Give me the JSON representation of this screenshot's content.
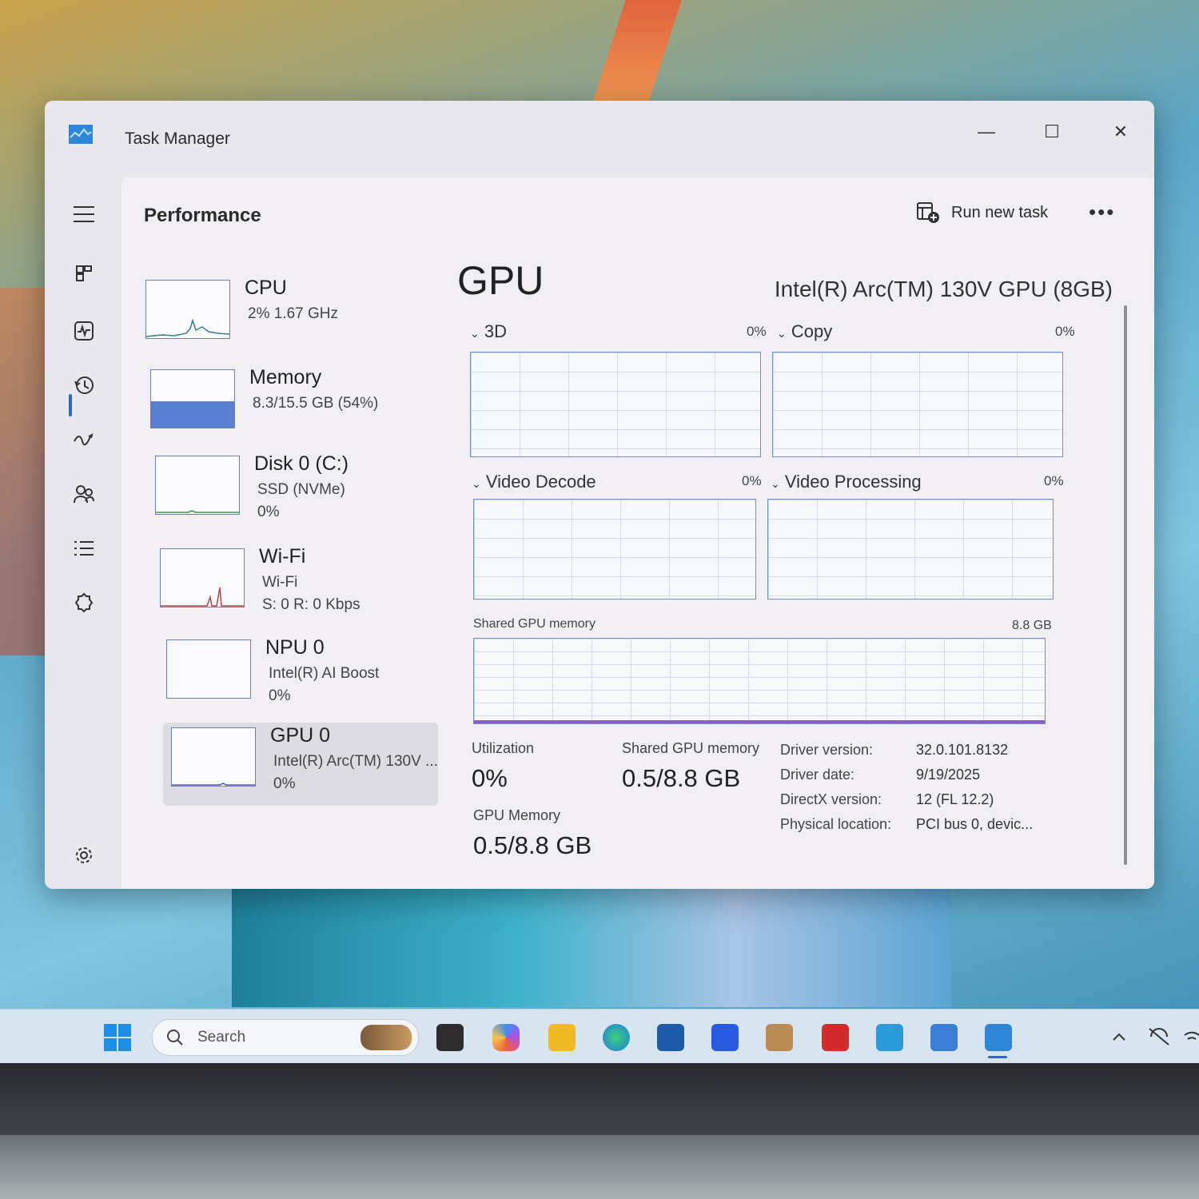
{
  "window": {
    "title": "Task Manager",
    "controls": {
      "minimize": "—",
      "maximize": "☐",
      "close": "✕"
    }
  },
  "header": {
    "title": "Performance",
    "run_task_label": "Run new task",
    "more_label": "•••"
  },
  "devices": [
    {
      "name": "CPU",
      "line1": "2%  1.67 GHz",
      "line2": ""
    },
    {
      "name": "Memory",
      "line1": "8.3/15.5 GB (54%)",
      "line2": ""
    },
    {
      "name": "Disk 0 (C:)",
      "line1": "SSD (NVMe)",
      "line2": "0%"
    },
    {
      "name": "Wi-Fi",
      "line1": "Wi-Fi",
      "line2": "S: 0  R: 0 Kbps"
    },
    {
      "name": "NPU 0",
      "line1": "Intel(R) AI Boost",
      "line2": "0%"
    },
    {
      "name": "GPU 0",
      "line1": "Intel(R) Arc(TM) 130V ...",
      "line2": "0%"
    }
  ],
  "gpu": {
    "title": "GPU",
    "model": "Intel(R) Arc(TM) 130V GPU (8GB)",
    "engines": [
      {
        "label": "3D",
        "pct": "0%"
      },
      {
        "label": "Copy",
        "pct": "0%"
      },
      {
        "label": "Video Decode",
        "pct": "0%"
      },
      {
        "label": "Video Processing",
        "pct": "0%"
      }
    ],
    "shared_memory": {
      "label": "Shared GPU memory",
      "max": "8.8 GB"
    },
    "stats": {
      "utilization_label": "Utilization",
      "utilization": "0%",
      "shared_label": "Shared GPU memory",
      "shared": "0.5/8.8 GB",
      "gpu_mem_label": "GPU Memory",
      "gpu_mem": "0.5/8.8 GB"
    },
    "properties": [
      {
        "key": "Driver version:",
        "value": "32.0.101.8132"
      },
      {
        "key": "Driver date:",
        "value": "9/19/2025"
      },
      {
        "key": "DirectX version:",
        "value": "12 (FL 12.2)"
      },
      {
        "key": "Physical location:",
        "value": "PCI bus 0, devic..."
      }
    ]
  },
  "taskbar": {
    "search_placeholder": "Search"
  },
  "colors": {
    "accent": "#2b68c8",
    "graph_border": "#6f8fbf",
    "memory_fill": "#4f74c4"
  }
}
